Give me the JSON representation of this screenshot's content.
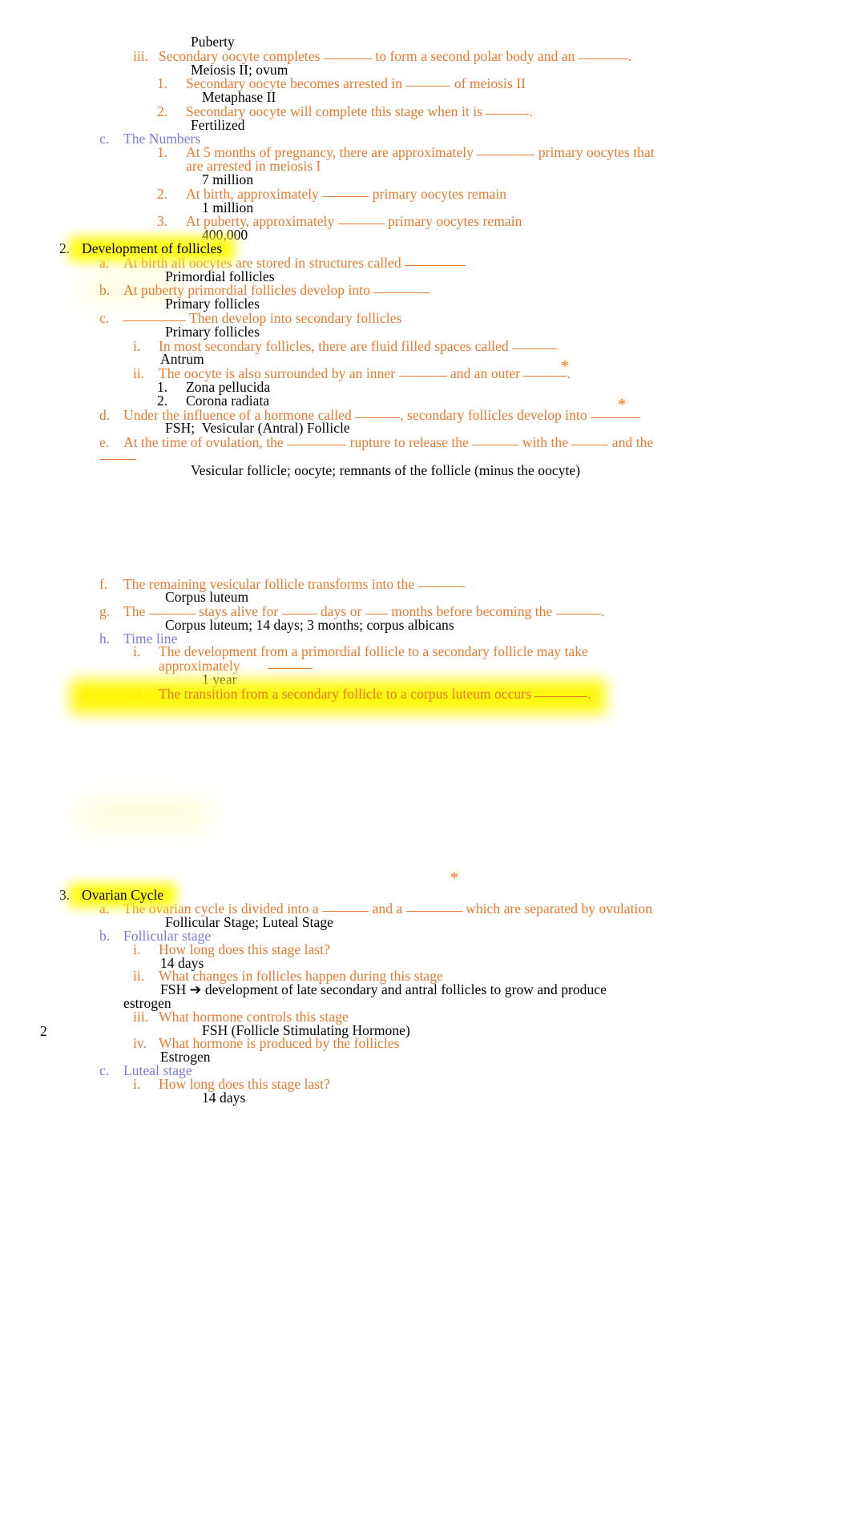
{
  "document": {
    "page_number": "2",
    "colors": {
      "question": "#e8792e",
      "subheading": "#7a7ae0",
      "answer": "#000000",
      "highlight": "#fffb00",
      "asterisk": "#e8792e"
    },
    "markers": {
      "asterisk": "*"
    },
    "blocks": [
      {
        "answer": "Puberty"
      },
      {
        "marker": "iii.",
        "q_a": "Secondary oocyte completes ",
        "q_b": " to form a second polar body and an ",
        "q_c": "."
      },
      {
        "answer": "Meiosis II; ovum"
      },
      {
        "marker": "1.",
        "q_a": "Secondary oocyte becomes arrested in ",
        "q_b": " of meiosis II"
      },
      {
        "answer": "Metaphase II"
      },
      {
        "marker": "2.",
        "q_a": "Secondary oocyte will complete this stage when it is ",
        "q_b": "."
      },
      {
        "answer": "Fertilized"
      },
      {
        "marker": "c.",
        "sub": "The Numbers"
      },
      {
        "marker": "1.",
        "q_a": "At 5 months of pregnancy, there are approximately ",
        "q_b": " primary oocytes that",
        "q_cont": "are arrested in meiosis I"
      },
      {
        "answer": "7 million"
      },
      {
        "marker": "2.",
        "q_a": "At birth, approximately ",
        "q_b": " primary oocytes remain"
      },
      {
        "answer": "1 million"
      },
      {
        "marker": "3.",
        "q_a": "At puberty, approximately ",
        "q_b": " primary oocytes remain"
      },
      {
        "answer": "400,000"
      }
    ]
  },
  "section2": {
    "number": "2.",
    "title": "Development of follicles",
    "items": {
      "a_marker": "a.",
      "a_text": "At birth all oocytes are stored in structures called ",
      "a_answer": "Primordial follicles",
      "b_marker": "b.",
      "b_text": "At puberty primordial follicles develop into ",
      "b_answer": "Primary follicles",
      "c_marker": "c.",
      "c_text": " Then develop into secondary follicles",
      "c_answer": "Primary follicles",
      "c_i_marker": "i.",
      "c_i_text": "In most secondary follicles, there are fluid filled spaces called ",
      "c_i_answer": "Antrum",
      "c_ii_marker": "ii.",
      "c_ii_text_a": "The oocyte is also surrounded by an inner ",
      "c_ii_text_b": " and an outer ",
      "c_ii_text_c": ".",
      "c_ii_1_marker": "1.",
      "c_ii_1_answer": "Zona pellucida",
      "c_ii_2_marker": "2.",
      "c_ii_2_answer": "Corona radiata",
      "d_marker": "d.",
      "d_text_a": "Under the influence of a hormone called ",
      "d_text_b": ", secondary follicles develop into ",
      "d_answer": "FSH;  Vesicular (Antral) Follicle",
      "e_marker": "e.",
      "e_text_a": "At the time of ovulation, the ",
      "e_text_b": " rupture to release the ",
      "e_text_c": " with the ",
      "e_text_d": " and the",
      "e_answer": "Vesicular follicle; oocyte; remnants of the follicle (minus the oocyte)",
      "f_marker": "f.",
      "f_text": "The remaining vesicular follicle transforms into the ",
      "f_answer": "Corpus luteum",
      "g_marker": "g.",
      "g_text_a": "The ",
      "g_text_b": " stays alive for ",
      "g_text_c": " days or ",
      "g_text_d": " months before becoming the ",
      "g_text_e": ".",
      "g_answer": "Corpus luteum; 14 days; 3 months; corpus albicans",
      "h_marker": "h.",
      "h_title": "Time line",
      "h_i_marker": "i.",
      "h_i_text": "The development from a primordial follicle to a secondary follicle may take",
      "h_i_cont": "approximately",
      "h_i_answer": "1 year",
      "h_ii_marker": "ii.",
      "h_ii_text": "The transition from a secondary follicle to a corpus luteum occurs ",
      "h_ii_end": "."
    }
  },
  "section3": {
    "number": "3.",
    "title": "Ovarian Cycle",
    "items": {
      "a_marker": "a.",
      "a_text_a": "The ovarian cycle is divided into a ",
      "a_text_b": " and a ",
      "a_text_c": " which are separated by ovulation",
      "a_answer": "Follicular Stage; Luteal Stage",
      "b_marker": "b.",
      "b_title": "Follicular stage",
      "b_i_marker": "i.",
      "b_i_text": "How long does this stage last?",
      "b_i_answer": "14 days",
      "b_ii_marker": "ii.",
      "b_ii_text": "What changes in follicles happen during this stage",
      "b_ii_answer": "FSH ➔ development of late secondary and antral follicles to grow and produce",
      "b_ii_answer_cont": "estrogen",
      "b_iii_marker": "iii.",
      "b_iii_text": "What hormone controls this stage",
      "b_iii_answer": "FSH (Follicle Stimulating Hormone)",
      "b_iv_marker": "iv.",
      "b_iv_text": "What hormone is produced by the follicles",
      "b_iv_answer": "Estrogen",
      "c_marker": "c.",
      "c_title": "Luteal stage",
      "c_i_marker": "i.",
      "c_i_text": "How long does this stage last?",
      "c_i_answer": "14 days"
    }
  }
}
